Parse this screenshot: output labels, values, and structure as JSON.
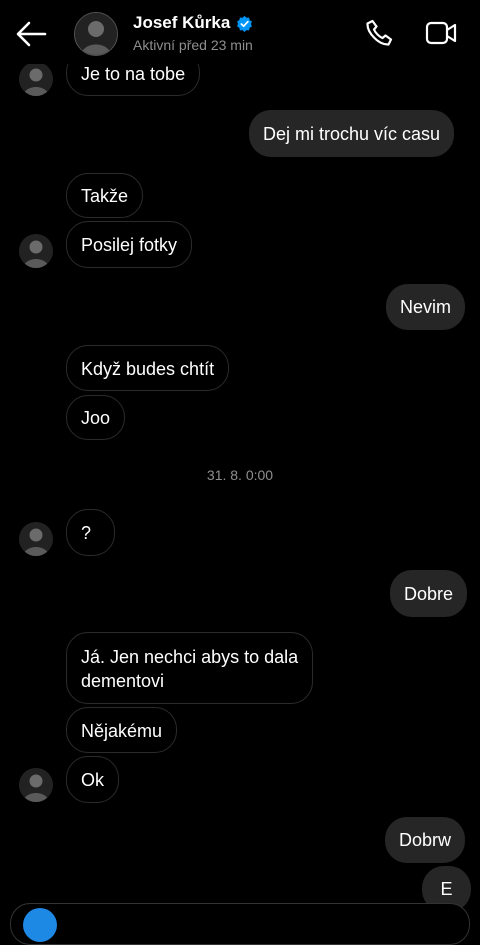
{
  "header": {
    "name": "Josef Kůrka",
    "status": "Aktivní před 23 min"
  },
  "messages": [
    {
      "text": "Je to na tobe"
    },
    {
      "text": "Dej mi trochu víc casu"
    },
    {
      "text": "Takže"
    },
    {
      "text": "Posilej fotky"
    },
    {
      "text": "Nevim"
    },
    {
      "text": "Když budes chtít"
    },
    {
      "text": "Joo"
    },
    {
      "text": "?"
    },
    {
      "text": "Dobre"
    },
    {
      "text": "Já. Jen nechci abys to dala"
    },
    {
      "text": "dementovi"
    },
    {
      "text": "Nějakému"
    },
    {
      "text": "Ok"
    },
    {
      "text": "Dobrw"
    },
    {
      "text": "E"
    }
  ],
  "timestamp": "31. 8. 0:00",
  "colors": {
    "background": "#000000",
    "incoming_border": "#2b2b2b",
    "outgoing_bubble": "#262626",
    "verified_badge": "#0095f6",
    "secondary_text": "#8e8e8e"
  },
  "icons": [
    "back-arrow-icon",
    "verified-badge-icon",
    "phone-icon",
    "video-camera-icon",
    "camera-icon"
  ]
}
